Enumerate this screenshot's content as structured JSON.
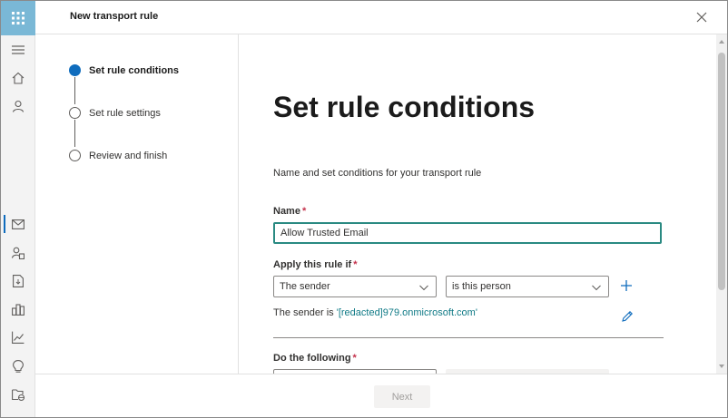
{
  "header": {
    "title": "New transport rule"
  },
  "rail": {
    "items": [
      {
        "icon": "waffle-icon"
      },
      {
        "icon": "hamburger-menu-icon"
      },
      {
        "icon": "home-icon"
      },
      {
        "icon": "person-icon"
      },
      {
        "icon": "mail-icon",
        "active": true
      },
      {
        "icon": "recipients-icon"
      },
      {
        "icon": "document-icon"
      },
      {
        "icon": "organization-icon"
      },
      {
        "icon": "reports-icon"
      },
      {
        "icon": "insights-icon"
      },
      {
        "icon": "public-folders-icon"
      }
    ]
  },
  "steps": [
    {
      "label": "Set rule conditions",
      "state": "current"
    },
    {
      "label": "Set rule settings",
      "state": "pending"
    },
    {
      "label": "Review and finish",
      "state": "pending"
    }
  ],
  "main": {
    "title": "Set rule conditions",
    "description": "Name and set conditions for your transport rule",
    "name_label": "Name",
    "name_value": "Allow Trusted Email",
    "apply_label": "Apply this rule if",
    "condition_select": "The sender",
    "condition_operator": "is this person",
    "sender_prefix": "The sender is",
    "sender_value": "'[redacted]979.onmicrosoft.com'",
    "do_label": "Do the following",
    "required_marker": "*"
  },
  "footer": {
    "next_label": "Next"
  },
  "colors": {
    "accent": "#0f6cbd",
    "focus_border": "#2a8a82",
    "link": "#0f7a86",
    "required": "#c4314b",
    "waffle_bg": "#7ab8d6"
  }
}
